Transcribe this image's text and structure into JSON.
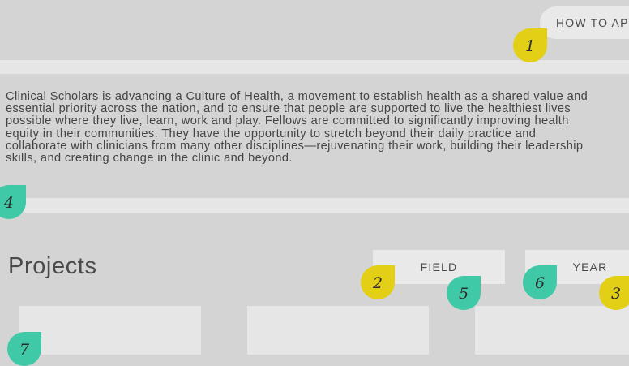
{
  "header": {
    "apply_label": "HOW TO APPLY"
  },
  "intro": {
    "text": "Clinical Scholars is advancing a Culture of Health, a movement to establish health as a shared value and\nessential priority across the nation, and to ensure that people are supported to live the healthiest lives\npossible where they live, learn, work and play. Fellows are committed to significantly improving health\nequity in their communities. They have the opportunity to stretch beyond their daily practice and\ncollaborate with clinicians from many other disciplines—rejuvenating their work, building their leadership\nskills, and creating change in the clinic and beyond."
  },
  "projects": {
    "title": "Projects",
    "filters": {
      "field_label": "FIELD",
      "year_label": "YEAR"
    }
  },
  "markers": [
    {
      "id": "1",
      "color": "#e2cf16"
    },
    {
      "id": "2",
      "color": "#e2cf16"
    },
    {
      "id": "3",
      "color": "#e2cf16"
    },
    {
      "id": "4",
      "color": "#3fc9a6"
    },
    {
      "id": "5",
      "color": "#3fc9a6"
    },
    {
      "id": "6",
      "color": "#3fc9a6"
    },
    {
      "id": "7",
      "color": "#3fc9a6"
    }
  ],
  "colors": {
    "background": "#d4d4d4",
    "band": "#e6e6e6",
    "yellow": "#e2cf16",
    "teal": "#3fc9a6"
  }
}
